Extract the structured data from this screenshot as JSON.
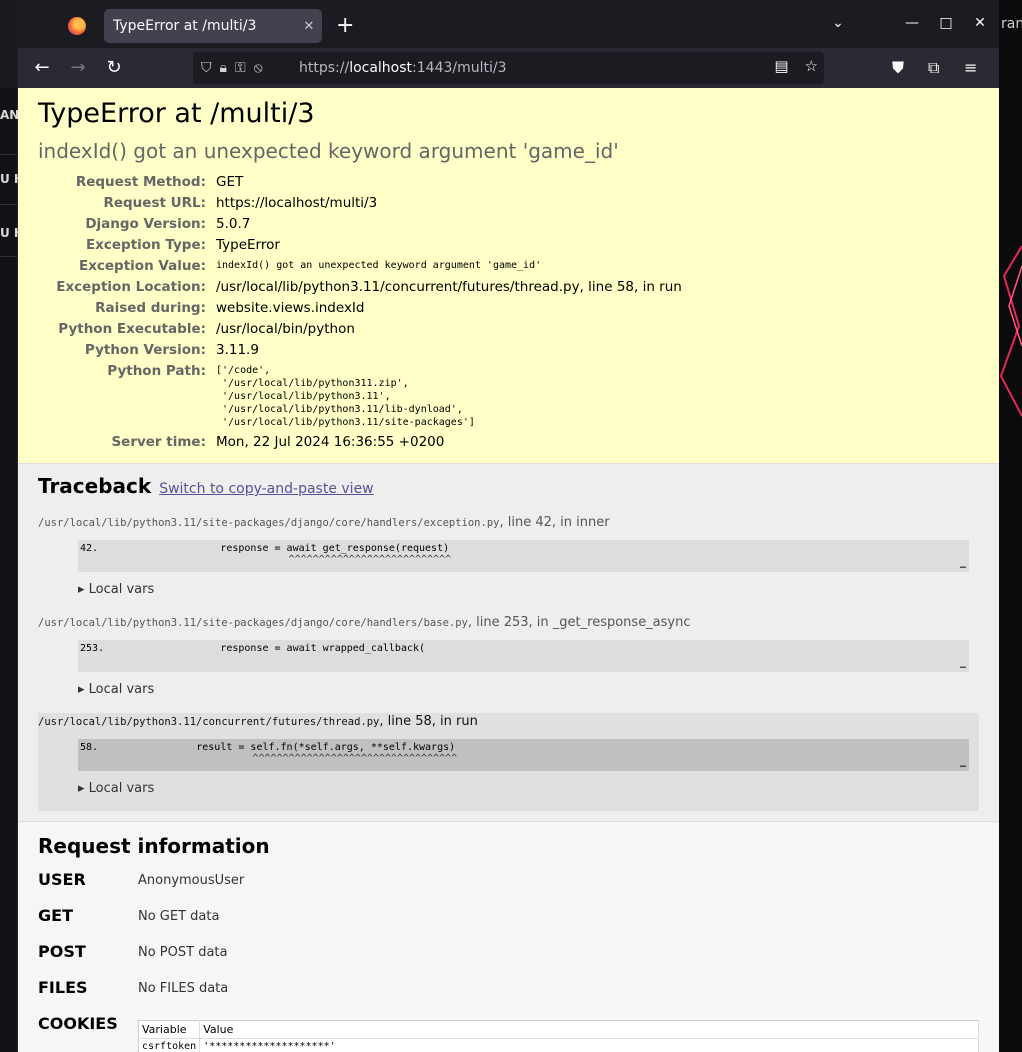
{
  "background_app": {
    "left_fragments": [
      "ANS",
      "U HA",
      "U HA"
    ],
    "right_fragment": "ran"
  },
  "browser": {
    "tab": {
      "title": "TypeError at /multi/3",
      "close": "✕"
    },
    "new_tab": "+",
    "window_controls": {
      "list": "⌄",
      "minimize": "—",
      "maximize": "□",
      "close": "✕"
    },
    "url": {
      "scheme": "https://",
      "host": "localhost",
      "rest": ":1443/multi/3"
    }
  },
  "error": {
    "title": "TypeError at /multi/3",
    "message": "indexId() got an unexpected keyword argument 'game_id'",
    "meta": [
      {
        "key": "Request Method:",
        "value": "GET"
      },
      {
        "key": "Request URL:",
        "value": "https://localhost/multi/3"
      },
      {
        "key": "Django Version:",
        "value": "5.0.7"
      },
      {
        "key": "Exception Type:",
        "value": "TypeError"
      },
      {
        "key": "Exception Value:",
        "value": "indexId() got an unexpected keyword argument 'game_id'",
        "mono": true
      },
      {
        "key": "Exception Location:",
        "value": "/usr/local/lib/python3.11/concurrent/futures/thread.py, line 58, in run"
      },
      {
        "key": "Raised during:",
        "value": "website.views.indexId"
      },
      {
        "key": "Python Executable:",
        "value": "/usr/local/bin/python"
      },
      {
        "key": "Python Version:",
        "value": "3.11.9"
      }
    ],
    "python_path_key": "Python Path:",
    "python_path": "['/code',\n '/usr/local/lib/python311.zip',\n '/usr/local/lib/python3.11',\n '/usr/local/lib/python3.11/lib-dynload',\n '/usr/local/lib/python3.11/site-packages']",
    "server_time_key": "Server time:",
    "server_time": "Mon, 22 Jul 2024 16:36:55 +0200"
  },
  "traceback": {
    "title": "Traceback",
    "switch_link": "Switch to copy-and-paste view",
    "local_vars": "▸ Local vars",
    "frames": [
      {
        "path": "/usr/local/lib/python3.11/site-packages/django/core/handlers/exception.py",
        "loc": ", line 42, in inner",
        "lineno": "42.",
        "src": "                response = await get_response(request)",
        "caret": "                           ^^^^^^^^^^^^^^^^^^^^^^^^^^^",
        "ellipsis": "…"
      },
      {
        "path": "/usr/local/lib/python3.11/site-packages/django/core/handlers/base.py",
        "loc": ", line 253, in _get_response_async",
        "lineno": "253.",
        "src": "                response = await wrapped_callback(",
        "caret": "",
        "ellipsis": "…"
      },
      {
        "path": "/usr/local/lib/python3.11/concurrent/futures/thread.py",
        "loc": ", line 58, in run",
        "lineno": "58.",
        "src": "            result = self.fn(*self.args, **self.kwargs)",
        "caret": "                     ^^^^^^^^^^^^^^^^^^^^^^^^^^^^^^^^^^",
        "ellipsis": "…"
      }
    ]
  },
  "request_info": {
    "title": "Request information",
    "rows": [
      {
        "key": "USER",
        "value": "AnonymousUser"
      },
      {
        "key": "GET",
        "value": "No GET data"
      },
      {
        "key": "POST",
        "value": "No POST data"
      },
      {
        "key": "FILES",
        "value": "No FILES data"
      }
    ],
    "cookies_key": "COOKIES",
    "cookies_headers": [
      "Variable",
      "Value"
    ],
    "cookies": [
      {
        "name": "csrftoken",
        "value": "'********************'"
      }
    ]
  }
}
